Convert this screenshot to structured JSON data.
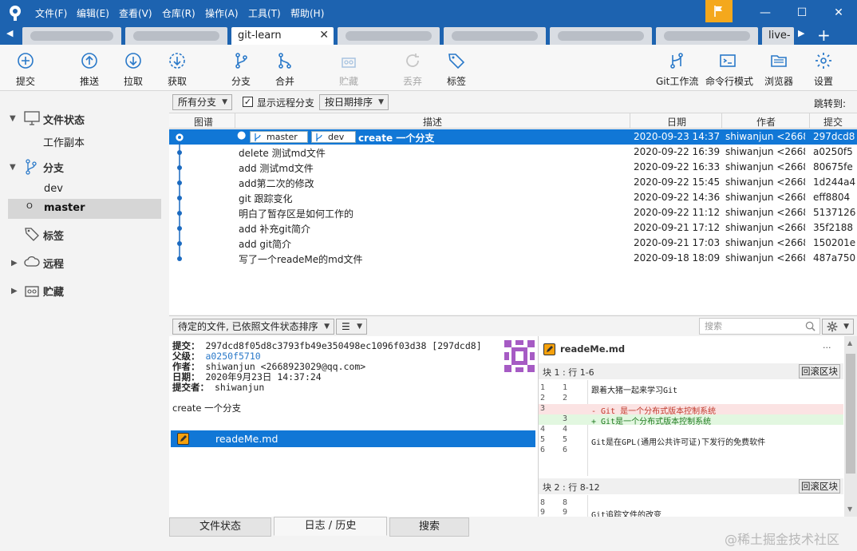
{
  "window": {
    "menu": [
      "文件(F)",
      "编辑(E)",
      "查看(V)",
      "仓库(R)",
      "操作(A)",
      "工具(T)",
      "帮助(H)"
    ],
    "controls": {
      "minimize": "—",
      "maximize": "☐",
      "close": "✕"
    }
  },
  "tabs": {
    "active_label": "git-learn",
    "last_label": "live-",
    "add": "+",
    "close": "✕"
  },
  "toolbar": {
    "commit": "提交",
    "push": "推送",
    "pull": "拉取",
    "fetch": "获取",
    "branch": "分支",
    "merge": "合并",
    "stash": "贮藏",
    "discard": "丢弃",
    "tag": "标签",
    "git_flow": "Git工作流",
    "terminal": "命令行模式",
    "explorer": "浏览器",
    "settings": "设置"
  },
  "sidebar": {
    "file_status": "文件状态",
    "working_copy": "工作副本",
    "branches": "分支",
    "branch_items": [
      "dev",
      "master"
    ],
    "tags": "标签",
    "remotes": "远程",
    "stashes": "贮藏"
  },
  "filter": {
    "all_branches": "所有分支",
    "show_remote": "显示远程分支",
    "sort": "按日期排序",
    "jump_to": "跳转到:"
  },
  "log": {
    "columns": {
      "graph": "图谱",
      "description": "描述",
      "date": "日期",
      "author": "作者",
      "commit": "提交"
    },
    "rows": [
      {
        "desc": "create 一个分支",
        "date": "2020-09-23 14:37",
        "author": "shiwanjun <2668",
        "hash": "297dcd8",
        "branches": [
          "master",
          "dev"
        ]
      },
      {
        "desc": "delete 测试md文件",
        "date": "2020-09-22 16:39",
        "author": "shiwanjun <2668",
        "hash": "a0250f5"
      },
      {
        "desc": "add 测试md文件",
        "date": "2020-09-22 16:33",
        "author": "shiwanjun <2668",
        "hash": "80675fe"
      },
      {
        "desc": "add第二次的修改",
        "date": "2020-09-22 15:45",
        "author": "shiwanjun <2668",
        "hash": "1d244a4"
      },
      {
        "desc": "git 跟踪变化",
        "date": "2020-09-22 14:36",
        "author": "shiwanjun <2668",
        "hash": "eff8804"
      },
      {
        "desc": "明白了暂存区是如何工作的",
        "date": "2020-09-22 11:12",
        "author": "shiwanjun <2668",
        "hash": "5137126"
      },
      {
        "desc": "add 补充git简介",
        "date": "2020-09-21 17:12",
        "author": "shiwanjun <2668",
        "hash": "35f2188"
      },
      {
        "desc": "add git简介",
        "date": "2020-09-21 17:03",
        "author": "shiwanjun <2668",
        "hash": "150201e"
      },
      {
        "desc": "写了一个readeMe的md文件",
        "date": "2020-09-18 18:09",
        "author": "shiwanjun <2668",
        "hash": "487a750"
      }
    ]
  },
  "lower": {
    "pending_filter": "待定的文件, 已依照文件状态排序",
    "search_placeholder": "搜索"
  },
  "details": {
    "commit_label": "提交：",
    "commit_value": "297dcd8f05d8c3793fb49e350498ec1096f03d38 [297dcd8]",
    "parent_label": "父级：",
    "parent_value": "a0250f5710",
    "author_label": "作者：",
    "author_value": "shiwanjun <2668923029@qq.com>",
    "date_label": "日期：",
    "date_value": "2020年9月23日 14:37:24",
    "committer_label": "提交者：",
    "committer_value": "shiwanjun",
    "message": "create 一个分支"
  },
  "files": {
    "file_name": "readeMe.md"
  },
  "diff": {
    "file_name": "readeMe.md",
    "more": "···",
    "revert": "回滚区块",
    "hunk1_title": "块 1 :  行 1-6",
    "hunk2_title": "块 2 :  行 8-12",
    "hunk1_lines": [
      {
        "a": "1",
        "b": "1",
        "t": "  跟着大猪一起来学习Git",
        "k": "ctx"
      },
      {
        "a": "2",
        "b": "2",
        "t": "",
        "k": "ctx"
      },
      {
        "a": "3",
        "b": "",
        "t": "- Git 是一个分布式版本控制系统",
        "k": "del"
      },
      {
        "a": "",
        "b": "3",
        "t": "+ Git是一个分布式版本控制系统",
        "k": "add"
      },
      {
        "a": "4",
        "b": "4",
        "t": "",
        "k": "ctx"
      },
      {
        "a": "5",
        "b": "5",
        "t": "  Git是在GPL(通用公共许可证)下发行的免费软件",
        "k": "ctx"
      },
      {
        "a": "6",
        "b": "6",
        "t": "",
        "k": "ctx"
      }
    ],
    "hunk2_lines": [
      {
        "a": "8",
        "b": "8",
        "t": "",
        "k": "ctx"
      },
      {
        "a": "9",
        "b": "9",
        "t": "  Git追踪文件的改变",
        "k": "ctx"
      }
    ]
  },
  "bottom_tabs": {
    "file_status": "文件状态",
    "log_history": "日志 / 历史",
    "search": "搜索"
  },
  "watermark": "@稀土掘金技术社区",
  "colors": {
    "titlebar": "#1d63b0",
    "selection": "#1177d6",
    "flag": "#f4a81c"
  }
}
